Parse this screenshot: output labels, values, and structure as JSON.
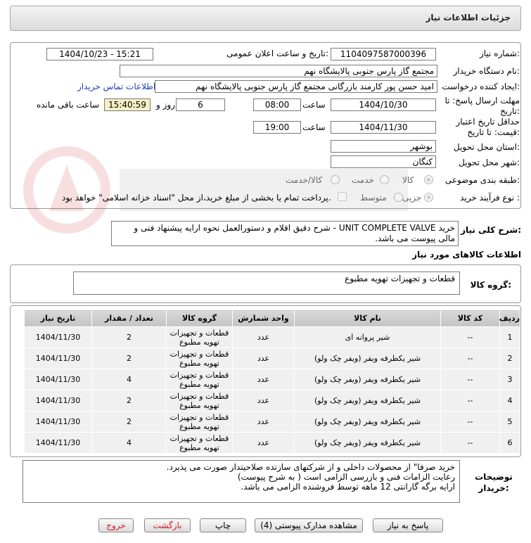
{
  "header": {
    "title": "جزئیات اطلاعات نیاز"
  },
  "form": {
    "need_number_label": "شماره نیاز:",
    "need_number": "1104097587000396",
    "announce_label": "تاریخ و ساعت اعلان عمومی:",
    "announce_value": "1404/10/23 - 15:21",
    "buyer_org_label": "نام دستگاه خریدار:",
    "buyer_org": "مجتمع گاز پارس جنوبی  پالایشگاه نهم",
    "creator_label": "ایجاد کننده درخواست:",
    "creator": "امید حسن پور کارمند بازرگانی مجتمع گاز پارس جنوبی  پالایشگاه نهم",
    "contact_link": "اطلاعات تماس خریدار",
    "deadline_label": "مهلت ارسال پاسخ: تا تاریخ:",
    "deadline_date": "1404/10/30",
    "hour_label": "ساعت",
    "deadline_time": "08:00",
    "days_value": "6",
    "days_label": "روز و",
    "remaining_time": "15:40:59",
    "remaining_label": "ساعت باقی مانده",
    "validity_label": "حداقل تاریخ اعتبار قیمت: تا تاریخ:",
    "validity_date": "1404/11/30",
    "validity_hour_label": "ساعت",
    "validity_time": "19:00",
    "province_label": "استان محل تحویل:",
    "province": "بوشهر",
    "city_label": "شهر محل تحویل:",
    "city": "کنگان",
    "category_label": "طبقه بندی موضوعی:",
    "category_options": [
      "کالا",
      "خدمت",
      "کالا/خدمت"
    ],
    "process_label": "نوع فرآیند خرید :",
    "process_options": [
      "جزیی",
      "متوسط"
    ],
    "payment_note": "پرداخت تمام یا بخشی از مبلغ خرید،از محل \"اسناد خزانه اسلامی\" خواهد بود."
  },
  "summary": {
    "label": "شرح کلی نیاز:",
    "text": "خرید UNIT COMPLETE VALVE - شرح دقیق اقلام و دستورالعمل نحوه ارایه پیشنهاد فنی و مالی پیوست می باشد."
  },
  "goods": {
    "section_title": "اطلاعات کالاهای مورد نیاز",
    "group_label": "گروه کالا:",
    "group_value": "قطعات و تجهیزات تهویه مطبوع"
  },
  "table": {
    "headers": [
      "ردیف",
      "کد کالا",
      "نام کالا",
      "واحد شمارش",
      "گروه کالا",
      "تعداد / مقدار",
      "تاریخ نیاز"
    ],
    "rows": [
      [
        "1",
        "--",
        "شیر پروانه ای",
        "عدد",
        "قطعات و تجهیزات تهویه مطبوع",
        "2",
        "1404/11/30"
      ],
      [
        "2",
        "--",
        "شیر یکطرفه ویفر (ویفر چک ولو)",
        "عدد",
        "قطعات و تجهیزات تهویه مطبوع",
        "2",
        "1404/11/30"
      ],
      [
        "3",
        "--",
        "شیر یکطرفه ویفر (ویفر چک ولو)",
        "عدد",
        "قطعات و تجهیزات تهویه مطبوع",
        "4",
        "1404/11/30"
      ],
      [
        "4",
        "--",
        "شیر یکطرفه ویفر (ویفر چک ولو)",
        "عدد",
        "قطعات و تجهیزات تهویه مطبوع",
        "2",
        "1404/11/30"
      ],
      [
        "5",
        "--",
        "شیر یکطرفه ویفر (ویفر چک ولو)",
        "عدد",
        "قطعات و تجهیزات تهویه مطبوع",
        "2",
        "1404/11/30"
      ],
      [
        "6",
        "--",
        "شیر یکطرفه ویفر (ویفر چک ولو)",
        "عدد",
        "قطعات و تجهیزات تهویه مطبوع",
        "4",
        "1404/11/30"
      ]
    ]
  },
  "notes": {
    "label": "توضیحات خریدار:",
    "lines": [
      "خرید صرفا\" از محصولات داخلی و از شرکتهای سازنده صلاحیتدار صورت می پذیرد.",
      "رعایت الزامات فنی و بازرسی الزامی است ( به شرح پیوست)",
      "ارایه برگه گارانتی 12 ماهه توسط فروشنده الزامی  می باشد."
    ]
  },
  "buttons": {
    "reply": "پاسخ به نیاز",
    "attachments": "مشاهده مدارک پیوستی (4)",
    "print": "چاپ",
    "back": "بازگشت",
    "exit": "خروج"
  },
  "colors": {
    "link": "#1a3fbf",
    "remaining_bg": "#f5f0c4",
    "exit_red": "#d9182d"
  }
}
